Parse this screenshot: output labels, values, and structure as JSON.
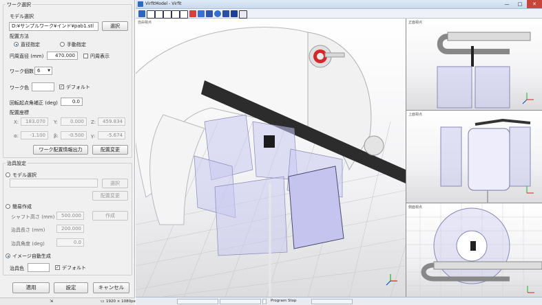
{
  "work": {
    "group_title": "ワーク選択",
    "model_label": "モデル選択",
    "model_path": "D:¥サンプルワーク¥インド¥pab1.stl",
    "select_button": "選択",
    "placement_label": "配置方法",
    "radio_diameter": "直径指定",
    "radio_manual": "手動指定",
    "circ_diameter_label": "円周直径 (mm)",
    "circ_diameter_value": "470.000",
    "circ_display_label": "円周表示",
    "count_label": "ワーク個数",
    "count_value": "6",
    "color_label": "ワーク色",
    "default_label": "デフォルト",
    "rot_label": "回転起点角補正 (deg)",
    "rot_value": "0.0",
    "coords_label": "配置座標",
    "x_label": "X:",
    "x_value": "183.070",
    "y_label": "Y:",
    "y_value": "0.000",
    "z_label": "Z:",
    "z_value": "459.834",
    "a_label": "α:",
    "a_value": "-1.100",
    "b_label": "β:",
    "b_value": "-0.500",
    "g_label": "γ:",
    "g_value": "-5.674",
    "export_button": "ワーク配置情報出力",
    "change_button": "配置変更"
  },
  "jig": {
    "group_title": "治具設定",
    "model_radio": "モデル選択",
    "select_button": "選択",
    "change_button": "配置変更",
    "simple_radio": "簡易作成",
    "shaft_label": "シャフト高さ (mm)",
    "shaft_value": "500.000",
    "create_button": "作成",
    "length_label": "治具長さ (mm)",
    "length_value": "200.000",
    "angle_label": "治具角度 (deg)",
    "angle_value": "0.0",
    "auto_radio": "イメージ自動生成",
    "color_label": "治具色",
    "default_label": "デフォルト"
  },
  "footer": {
    "apply_button": "適用",
    "settings_button": "設定",
    "cancel_button": "キャンセル"
  },
  "status_left": {
    "resolution": "1920 × 1080px"
  },
  "window": {
    "title": "VirfitModel - Virfit",
    "minimize": "—",
    "maximize": "□",
    "close": "✕"
  },
  "viewports": {
    "main": "自由視点",
    "top_right": "正面視点",
    "mid_right": "上面視点",
    "bottom_right": "側面視点"
  },
  "status": {
    "program": "Program Stop"
  },
  "colors": {
    "accent": "#1b5fb8",
    "close": "#c7453a",
    "work_tint": "#c8c8f0"
  }
}
